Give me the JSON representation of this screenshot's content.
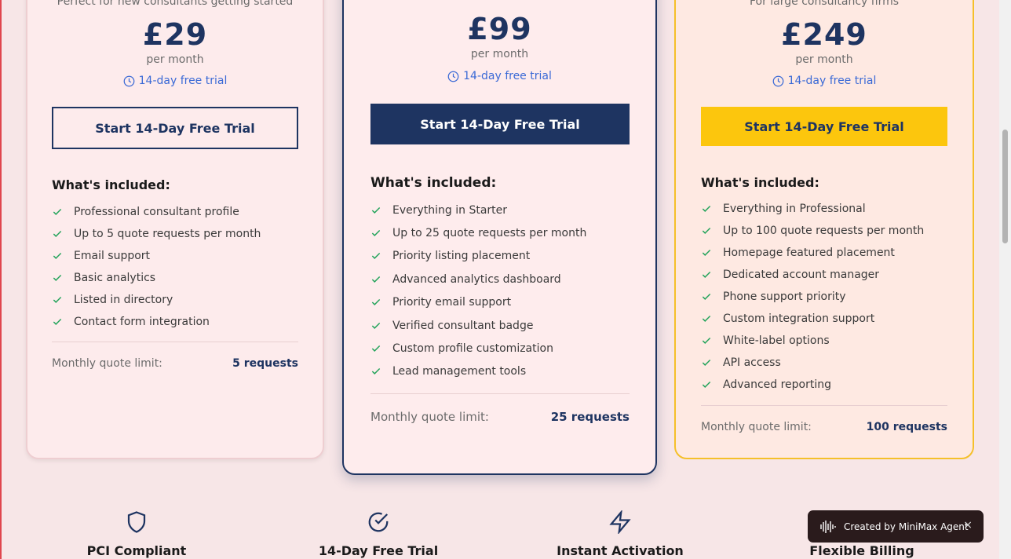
{
  "plans": [
    {
      "tagline": "Perfect for new consultants getting started",
      "price": "£29",
      "period": "per month",
      "trial": "14-day free trial",
      "cta": "Start 14-Day Free Trial",
      "included_title": "What's included:",
      "features": [
        "Professional consultant profile",
        "Up to 5 quote requests per month",
        "Email support",
        "Basic analytics",
        "Listed in directory",
        "Contact form integration"
      ],
      "limit_label": "Monthly quote limit:",
      "limit_value": "5 requests"
    },
    {
      "tagline": "",
      "price": "£99",
      "period": "per month",
      "trial": "14-day free trial",
      "cta": "Start 14-Day Free Trial",
      "included_title": "What's included:",
      "features": [
        "Everything in Starter",
        "Up to 25 quote requests per month",
        "Priority listing placement",
        "Advanced analytics dashboard",
        "Priority email support",
        "Verified consultant badge",
        "Custom profile customization",
        "Lead management tools"
      ],
      "limit_label": "Monthly quote limit:",
      "limit_value": "25 requests"
    },
    {
      "tagline": "For large consultancy firms",
      "price": "£249",
      "period": "per month",
      "trial": "14-day free trial",
      "cta": "Start 14-Day Free Trial",
      "included_title": "What's included:",
      "features": [
        "Everything in Professional",
        "Up to 100 quote requests per month",
        "Homepage featured placement",
        "Dedicated account manager",
        "Phone support priority",
        "Custom integration support",
        "White-label options",
        "API access",
        "Advanced reporting"
      ],
      "limit_label": "Monthly quote limit:",
      "limit_value": "100 requests"
    }
  ],
  "trust": [
    {
      "icon": "shield-icon",
      "label": "PCI Compliant"
    },
    {
      "icon": "check-circle-icon",
      "label": "14-Day Free Trial"
    },
    {
      "icon": "lightning-icon",
      "label": "Instant Activation"
    },
    {
      "icon": "",
      "label": "Flexible Billing"
    }
  ],
  "badge": {
    "text": "Created by MiniMax Agent",
    "close": "×"
  },
  "colors": {
    "navy": "#1e3461",
    "gold": "#fcc60d",
    "check": "#22a35a",
    "link": "#3b6ad6"
  }
}
